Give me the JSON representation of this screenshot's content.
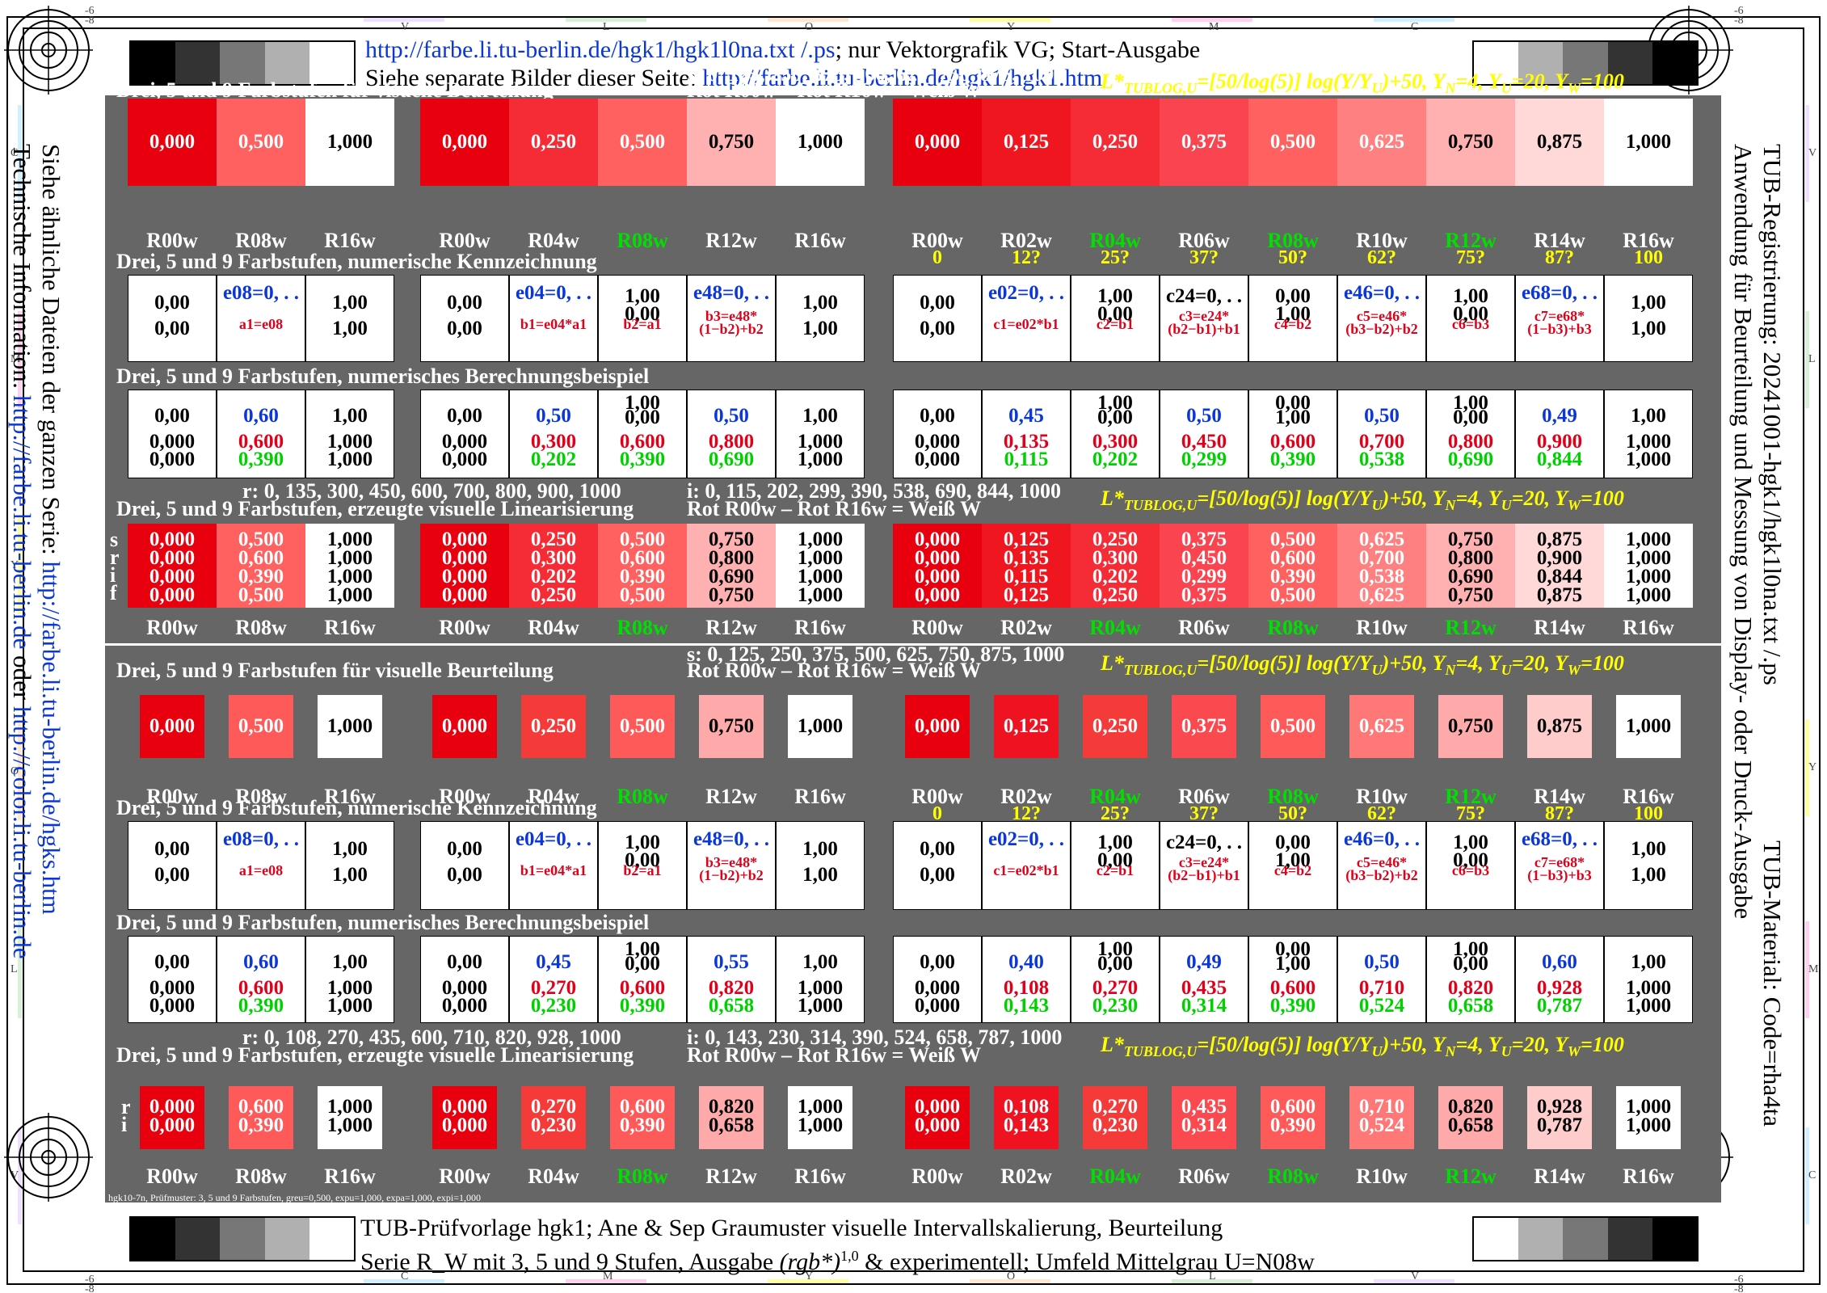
{
  "header": {
    "line1_link": "http://farbe.li.tu-berlin.de/hgk1/hgk1l0na.txt /.ps",
    "line1_rest": "; nur Vektorgrafik VG; Start-Ausgabe",
    "line2_text": "Siehe separate Bilder dieser Seite: ",
    "line2_link": "http://farbe.li.tu-berlin.de/hgk1/hgk1.htm"
  },
  "footer": {
    "line1": "TUB-Prüfvorlage hgk1; Ane & Sep Graumuster visuelle Intervallskalierung, Beurteilung",
    "line2_a": "Serie R_W mit 3, 5 und 9 Stufen, Ausgabe ",
    "line2_rgb": "(rgb*)",
    "line2_sup": "1,0",
    "line2_b": " & experimentell; Umfeld Mittelgrau U=N08w",
    "small": "hgk10-7n, Prüfmuster: 3, 5 und 9 Farbstufen, greu=0,500, expu=1,000, expa=1,000, expi=1,000"
  },
  "left_side": {
    "line1": "Siehe ähnliche Dateien der ganzen Serie: ",
    "line1_link": "http://farbe.li.tu-berlin.de/hgks.htm",
    "line2": "Technische Information: ",
    "line2_link1": "http://farbe.li.tu-berlin.de",
    "line2_mid": " oder ",
    "line2_link2": "http://color.li.tu-berlin.de"
  },
  "right_side": {
    "line1": "TUB-Registrierung: 20241001-hgk1/hgk1l0na.txt /.ps",
    "line2": "Anwendung für Beurteilung und Messung von Display- oder Druck-Ausgabe",
    "line3": "TUB-Material: Code=rha4ta"
  },
  "marks": {
    "top": [
      "V",
      "L",
      "O",
      "Y",
      "M",
      "C"
    ],
    "bottom": [
      "C",
      "M",
      "Y",
      "O",
      "L",
      "V"
    ],
    "left": [
      "C",
      "M",
      "Y",
      "O",
      "L",
      "V"
    ],
    "right": [
      "V",
      "L",
      "Y",
      "M",
      "C"
    ],
    "corner_a": "-6",
    "corner_b": "-8"
  },
  "formula": {
    "pre": "L*",
    "sub": "TUBLOG,U",
    "mid": "=[50/log(5)] log(Y/Y",
    "sub2": "U",
    "end": ")+50, Y",
    "n": "N",
    "e2": "=4, Y",
    "u": "U",
    "e3": "=20, Y",
    "w": "W",
    "e4": "=100"
  },
  "sections": {
    "visual": "Drei, 5 und 9 Farbstufen für visuelle Beurteilung",
    "numeric": "Drei, 5 und 9 Farbstufen, numerische Kennzeichnung",
    "example": "Drei, 5 und 9 Farbstufen, numerisches Berechnungsbeispiel",
    "linear": "Drei, 5 und 9 Farbstufen, erzeugte visuelle Linearisierung",
    "rot": "Rot R00w – Rot R16w = Weiß W"
  },
  "top_half": {
    "s_line": "s: 0, 125, 250, 375, 500, 625, 750, 875, 1000",
    "r_line": "r: 0, 135, 300, 450, 600, 700, 800, 900, 1000",
    "i_line": "i: 0, 115, 202, 299, 390, 538, 690, 844, 1000",
    "srif": [
      "s",
      "r",
      "i",
      "f"
    ]
  },
  "bottom_half": {
    "s_line": "s: 0, 125, 250, 375, 500, 625, 750, 875, 1000",
    "r_line": "r: 0, 108, 270, 435, 600, 710, 820, 928, 1000",
    "i_line": "i: 0, 143, 230, 314, 390, 524, 658, 787, 1000",
    "ri": [
      "r",
      "i"
    ]
  },
  "groups": [
    {
      "labels": [
        "R00w",
        "R08w",
        "R16w"
      ],
      "green": [],
      "pct": [],
      "colors": [
        "#e8000f",
        "#ff6060",
        "#ffffff"
      ],
      "s": [
        "0,000",
        "0,500",
        "1,000"
      ],
      "num": [
        [
          "0,00",
          "0,00"
        ],
        [
          "e08=0, . .",
          "a1=e08"
        ],
        [
          "1,00",
          "1,00"
        ]
      ],
      "ex_top": [
        [
          "0,00",
          "0,000",
          "0,000"
        ],
        [
          "0,60",
          "0,600",
          "0,390"
        ],
        [
          "1,00",
          "1,000",
          "1,000"
        ]
      ],
      "lin_top": [
        [
          "0,000",
          "0,000",
          "0,000",
          "0,000"
        ],
        [
          "0,500",
          "0,600",
          "0,390",
          "0,500"
        ],
        [
          "1,000",
          "1,000",
          "1,000",
          "1,000"
        ]
      ],
      "ex_bot": [
        [
          "0,00",
          "0,000",
          "0,000"
        ],
        [
          "0,60",
          "0,600",
          "0,390"
        ],
        [
          "1,00",
          "1,000",
          "1,000"
        ]
      ],
      "lin_bot": [
        [
          "0,000",
          "0,000"
        ],
        [
          "0,600",
          "0,390"
        ],
        [
          "1,000",
          "1,000"
        ]
      ],
      "colors_bot": [
        "#e8000f",
        "#ff5a5a",
        "#ffffff"
      ]
    },
    {
      "labels": [
        "R00w",
        "R04w",
        "R08w",
        "R12w",
        "R16w"
      ],
      "green": [
        2
      ],
      "pct": [],
      "colors": [
        "#e8000f",
        "#f52b35",
        "#ff6060",
        "#ffb0b0",
        "#ffffff"
      ],
      "s": [
        "0,000",
        "0,250",
        "0,500",
        "0,750",
        "1,000"
      ],
      "num": [
        [
          "0,00",
          "0,00"
        ],
        [
          "e04=0, . .",
          "b1=e04*a1"
        ],
        [
          "1,00",
          "0,00",
          "b2=a1"
        ],
        [
          "e48=0, . .",
          "b3=e48*",
          "(1−b2)+b2"
        ],
        [
          "1,00",
          "1,00"
        ]
      ],
      "ex_top": [
        [
          "0,00",
          "0,000",
          "0,000"
        ],
        [
          "0,50",
          "0,300",
          "0,202"
        ],
        [
          "1,00",
          "0,00",
          "0,600",
          "0,390"
        ],
        [
          "0,50",
          "0,800",
          "0,690"
        ],
        [
          "1,00",
          "1,000",
          "1,000"
        ]
      ],
      "lin_top": [
        [
          "0,000",
          "0,000",
          "0,000",
          "0,000"
        ],
        [
          "0,250",
          "0,300",
          "0,202",
          "0,250"
        ],
        [
          "0,500",
          "0,600",
          "0,390",
          "0,500"
        ],
        [
          "0,750",
          "0,800",
          "0,690",
          "0,750"
        ],
        [
          "1,000",
          "1,000",
          "1,000",
          "1,000"
        ]
      ],
      "ex_bot": [
        [
          "0,00",
          "0,000",
          "0,000"
        ],
        [
          "0,45",
          "0,270",
          "0,230"
        ],
        [
          "1,00",
          "0,00",
          "0,600",
          "0,390"
        ],
        [
          "0,55",
          "0,820",
          "0,658"
        ],
        [
          "1,00",
          "1,000",
          "1,000"
        ]
      ],
      "lin_bot": [
        [
          "0,000",
          "0,000"
        ],
        [
          "0,270",
          "0,230"
        ],
        [
          "0,600",
          "0,390"
        ],
        [
          "0,820",
          "0,658"
        ],
        [
          "1,000",
          "1,000"
        ]
      ],
      "num_bot_b1": "b1=e04*a1",
      "colors_bot": [
        "#e8000f",
        "#f53a3a",
        "#ff5a5a",
        "#ffaaaa",
        "#ffffff"
      ]
    },
    {
      "labels": [
        "R00w",
        "R02w",
        "R04w",
        "R06w",
        "R08w",
        "R10w",
        "R12w",
        "R14w",
        "R16w"
      ],
      "green": [
        2,
        4,
        6
      ],
      "pct": [
        "0",
        "12?",
        "25?",
        "37?",
        "50?",
        "62?",
        "75?",
        "87?",
        "100"
      ],
      "colors": [
        "#e8000f",
        "#f0161f",
        "#f52b35",
        "#fa4550",
        "#ff6060",
        "#ff8080",
        "#ffb0b0",
        "#ffd8d8",
        "#ffffff"
      ],
      "s": [
        "0,000",
        "0,125",
        "0,250",
        "0,375",
        "0,500",
        "0,625",
        "0,750",
        "0,875",
        "1,000"
      ],
      "num": [
        [
          "0,00",
          "0,00"
        ],
        [
          "e02=0, . .",
          "c1=e02*b1"
        ],
        [
          "1,00",
          "0,00",
          "c2=b1"
        ],
        [
          "c24=0, . .",
          "c3=e24*",
          "(b2−b1)+b1"
        ],
        [
          "0,00",
          "1,00",
          "c4=b2"
        ],
        [
          "e46=0, . .",
          "c5=e46*",
          "(b3−b2)+b2"
        ],
        [
          "1,00",
          "0,00",
          "c6=b3"
        ],
        [
          "e68=0, . .",
          "c7=e68*",
          "(1−b3)+b3"
        ],
        [
          "1,00",
          "1,00"
        ]
      ],
      "ex_top": [
        [
          "0,00",
          "0,000",
          "0,000"
        ],
        [
          "0,45",
          "0,135",
          "0,115"
        ],
        [
          "1,00",
          "0,00",
          "0,300",
          "0,202"
        ],
        [
          "0,50",
          "0,450",
          "0,299"
        ],
        [
          "0,00",
          "1,00",
          "0,600",
          "0,390"
        ],
        [
          "0,50",
          "0,700",
          "0,538"
        ],
        [
          "1,00",
          "0,00",
          "0,800",
          "0,690"
        ],
        [
          "0,49",
          "0,900",
          "0,844"
        ],
        [
          "1,00",
          "1,000",
          "1,000"
        ]
      ],
      "lin_top": [
        [
          "0,000",
          "0,000",
          "0,000",
          "0,000"
        ],
        [
          "0,125",
          "0,135",
          "0,115",
          "0,125"
        ],
        [
          "0,250",
          "0,300",
          "0,202",
          "0,250"
        ],
        [
          "0,375",
          "0,450",
          "0,299",
          "0,375"
        ],
        [
          "0,500",
          "0,600",
          "0,390",
          "0,500"
        ],
        [
          "0,625",
          "0,700",
          "0,538",
          "0,625"
        ],
        [
          "0,750",
          "0,800",
          "0,690",
          "0,750"
        ],
        [
          "0,875",
          "0,900",
          "0,844",
          "0,875"
        ],
        [
          "1,000",
          "1,000",
          "1,000",
          "1,000"
        ]
      ],
      "ex_bot": [
        [
          "0,00",
          "0,000",
          "0,000"
        ],
        [
          "0,40",
          "0,108",
          "0,143"
        ],
        [
          "1,00",
          "0,00",
          "0,270",
          "0,230"
        ],
        [
          "0,49",
          "0,435",
          "0,314"
        ],
        [
          "0,00",
          "1,00",
          "0,600",
          "0,390"
        ],
        [
          "0,50",
          "0,710",
          "0,524"
        ],
        [
          "1,00",
          "0,00",
          "0,820",
          "0,658"
        ],
        [
          "0,60",
          "0,928",
          "0,787"
        ],
        [
          "1,00",
          "1,000",
          "1,000"
        ]
      ],
      "lin_bot": [
        [
          "0,000",
          "0,000"
        ],
        [
          "0,108",
          "0,143"
        ],
        [
          "0,270",
          "0,230"
        ],
        [
          "0,435",
          "0,314"
        ],
        [
          "0,600",
          "0,390"
        ],
        [
          "0,710",
          "0,524"
        ],
        [
          "0,820",
          "0,658"
        ],
        [
          "0,928",
          "0,787"
        ],
        [
          "1,000",
          "1,000"
        ]
      ],
      "colors_bot": [
        "#e8000f",
        "#ef1220",
        "#f53a3a",
        "#fa4a50",
        "#ff5a5a",
        "#ff7878",
        "#ffaaaa",
        "#ffcccc",
        "#ffffff"
      ]
    }
  ],
  "gray_wedge": [
    "#000000",
    "#333333",
    "#777777",
    "#b0b0b0",
    "#ffffff"
  ]
}
